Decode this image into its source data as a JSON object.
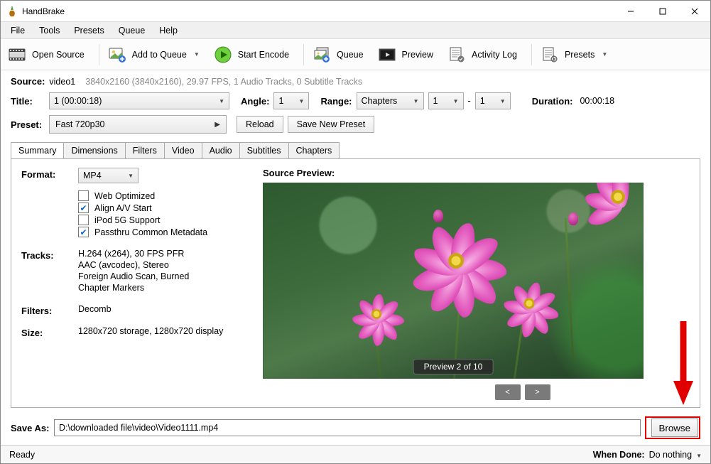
{
  "app": {
    "title": "HandBrake"
  },
  "menu": {
    "file": "File",
    "tools": "Tools",
    "presets": "Presets",
    "queue": "Queue",
    "help": "Help"
  },
  "toolbar": {
    "open_source": "Open Source",
    "add_to_queue": "Add to Queue",
    "start_encode": "Start Encode",
    "queue": "Queue",
    "preview": "Preview",
    "activity_log": "Activity Log",
    "presets": "Presets"
  },
  "source": {
    "label": "Source:",
    "name": "video1",
    "details": "3840x2160 (3840x2160), 29.97 FPS, 1 Audio Tracks, 0 Subtitle Tracks"
  },
  "title_row": {
    "title_label": "Title:",
    "title_value": "1  (00:00:18)",
    "angle_label": "Angle:",
    "angle_value": "1",
    "range_label": "Range:",
    "range_mode": "Chapters",
    "range_from": "1",
    "range_to": "1",
    "duration_label": "Duration:",
    "duration_value": "00:00:18"
  },
  "preset_row": {
    "label": "Preset:",
    "value": "Fast 720p30",
    "reload": "Reload",
    "save_new": "Save New Preset"
  },
  "tabs": {
    "summary": "Summary",
    "dimensions": "Dimensions",
    "filters": "Filters",
    "video": "Video",
    "audio": "Audio",
    "subtitles": "Subtitles",
    "chapters": "Chapters"
  },
  "summary": {
    "format_label": "Format:",
    "format_value": "MP4",
    "chk_web": "Web Optimized",
    "chk_align": "Align A/V Start",
    "chk_ipod": "iPod 5G Support",
    "chk_meta": "Passthru Common Metadata",
    "tracks_label": "Tracks:",
    "tracks_1": "H.264 (x264), 30 FPS PFR",
    "tracks_2": "AAC (avcodec), Stereo",
    "tracks_3": "Foreign Audio Scan, Burned",
    "tracks_4": "Chapter Markers",
    "filters_label": "Filters:",
    "filters_1": "Decomb",
    "size_label": "Size:",
    "size_1": "1280x720 storage, 1280x720 display",
    "preview_title": "Source Preview:",
    "preview_badge": "Preview 2 of 10"
  },
  "saveas": {
    "label": "Save As:",
    "path": "D:\\downloaded file\\video\\Video1111.mp4",
    "browse": "Browse"
  },
  "status": {
    "ready": "Ready",
    "when_done_label": "When Done:",
    "when_done_value": "Do nothing"
  }
}
